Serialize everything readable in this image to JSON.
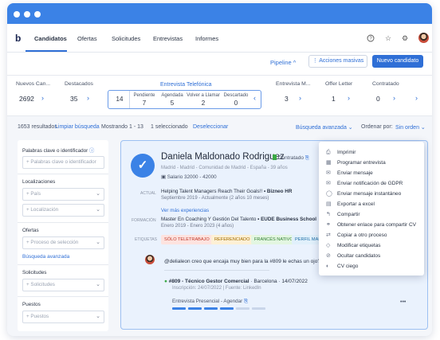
{
  "app": {
    "logo": "b"
  },
  "nav": {
    "tabs": [
      "Candidatos",
      "Ofertas",
      "Solicitudes",
      "Entrevistas",
      "Informes"
    ],
    "active": "Candidatos",
    "icons": [
      "help-icon",
      "star-icon",
      "gear-icon"
    ]
  },
  "actions": {
    "pipeline": "Pipeline ^",
    "bulk": "Acciones masivas",
    "new": "Nuevo candidato"
  },
  "stages": {
    "left": [
      {
        "name": "Nuevos Can...",
        "count": "2692"
      },
      {
        "name": "Destacados",
        "count": "35"
      }
    ],
    "current": {
      "name": "Entrevista Telefónica",
      "total": "14",
      "subs": [
        {
          "label": "Pendiente",
          "count": "7"
        },
        {
          "label": "Agendada",
          "count": "5"
        },
        {
          "label": "Volver a Llamar",
          "count": "2"
        },
        {
          "label": "Descartado",
          "count": "0"
        }
      ]
    },
    "right": [
      {
        "name": "Entrevista M...",
        "count": "3"
      },
      {
        "name": "Offer Letter",
        "count": "1"
      },
      {
        "name": "Contratado",
        "count": "0"
      }
    ]
  },
  "results": {
    "count": "1653 resultados",
    "clear": "Limpiar búsqueda",
    "showing": "Mostrando 1 - 13",
    "selected": "1 seleccionado",
    "deselect": "Deseleccionar",
    "advanced": "Búsqueda avanzada",
    "order_label": "Ordenar por:",
    "order_value": "Sin orden"
  },
  "sidebar": {
    "keywords_label": "Palabras clave o identificador",
    "keywords_placeholder": "+ Palabras clave o identificador",
    "locations_label": "Localizaciones",
    "country": "+ País",
    "location": "+ Localización",
    "offers_label": "Ofertas",
    "process": "+ Proceso de selección",
    "advanced_link": "Búsqueda avanzada",
    "requests_label": "Solicitudes",
    "requests": "+ Solicitudes",
    "positions_label": "Puestos",
    "positions": "+ Puestos"
  },
  "candidate": {
    "name": "Daniela Maldonado Rodriguez",
    "status": "Contratado",
    "location": "Madrid - Madrid - Comunidad de Madrid - España - 39 años",
    "salary": "Salario 32000 - 42000",
    "actual_label": "ACTUAL",
    "actual_role": "Helping Talent Managers Reach Their Goals!!",
    "actual_company": "• Bizneo HR",
    "actual_dates": "Septiembre 2019 - Actualmente (2 años 10 meses)",
    "more_exp": "Ver más experiencias",
    "formation_label": "FORMACIÓN",
    "formation_title": "Master En Coaching Y Gestión Del Talento",
    "formation_school": "• EUDE Business School",
    "formation_dates": "Enero 2019 - Enero 2023 (4 años)",
    "tags_label": "ETIQUETAS",
    "tags": [
      {
        "text": "SÓLO TELETRABAJO",
        "bg": "#fde3df",
        "color": "#c0392b"
      },
      {
        "text": "REFERENCIADO",
        "bg": "#fdf0d5",
        "color": "#a06b00"
      },
      {
        "text": "FRANCÉS NATIVO",
        "bg": "#e3f6e1",
        "color": "#2e7d32"
      },
      {
        "text": "PERFIL MAN",
        "bg": "#e1f0fb",
        "color": "#1f6fa8"
      }
    ],
    "comment": "@delialeon creo que encaja muy bien para la #809 le echas un ojo?",
    "application_title": "#809 - Técnico Gestor Comercial",
    "application_place": "· Barcelona · 14/07/2022",
    "application_meta": "Inscripción: 24/07/2022 | Fuente: LinkedIn",
    "application_stage": "Entrevista Presencial - Agendar",
    "progress_segments": 6,
    "progress_done": 4,
    "more": "•••"
  },
  "menu": [
    {
      "label": "Imprimir",
      "icon": "print-icon",
      "glyph": "⎙"
    },
    {
      "label": "Programar entrevista",
      "icon": "calendar-icon",
      "glyph": "▦"
    },
    {
      "label": "Enviar mensaje",
      "icon": "mail-icon",
      "glyph": "✉"
    },
    {
      "label": "Enviar notificación de GDPR",
      "icon": "mail-icon",
      "glyph": "✉"
    },
    {
      "label": "Enviar mensaje instantáneo",
      "icon": "chat-icon",
      "glyph": "◯"
    },
    {
      "label": "Exportar a excel",
      "icon": "file-icon",
      "glyph": "▤"
    },
    {
      "label": "Compartir",
      "icon": "share-icon",
      "glyph": "↰"
    },
    {
      "label": "Obtener enlace para compartir CV",
      "icon": "link-icon",
      "glyph": "⚭"
    },
    {
      "label": "Copiar a otro proceso",
      "icon": "copy-icon",
      "glyph": "⇄"
    },
    {
      "label": "Modificar etiquetas",
      "icon": "tag-icon",
      "glyph": "◇"
    },
    {
      "label": "Ocultar candidatos",
      "icon": "hide-icon",
      "glyph": "⊘"
    },
    {
      "label": "CV ciego",
      "icon": "eye-icon",
      "glyph": "◐"
    }
  ],
  "colors": {
    "accent": "#2f6fd6",
    "titlebar": "#3b82e6",
    "green": "#3aa845"
  }
}
